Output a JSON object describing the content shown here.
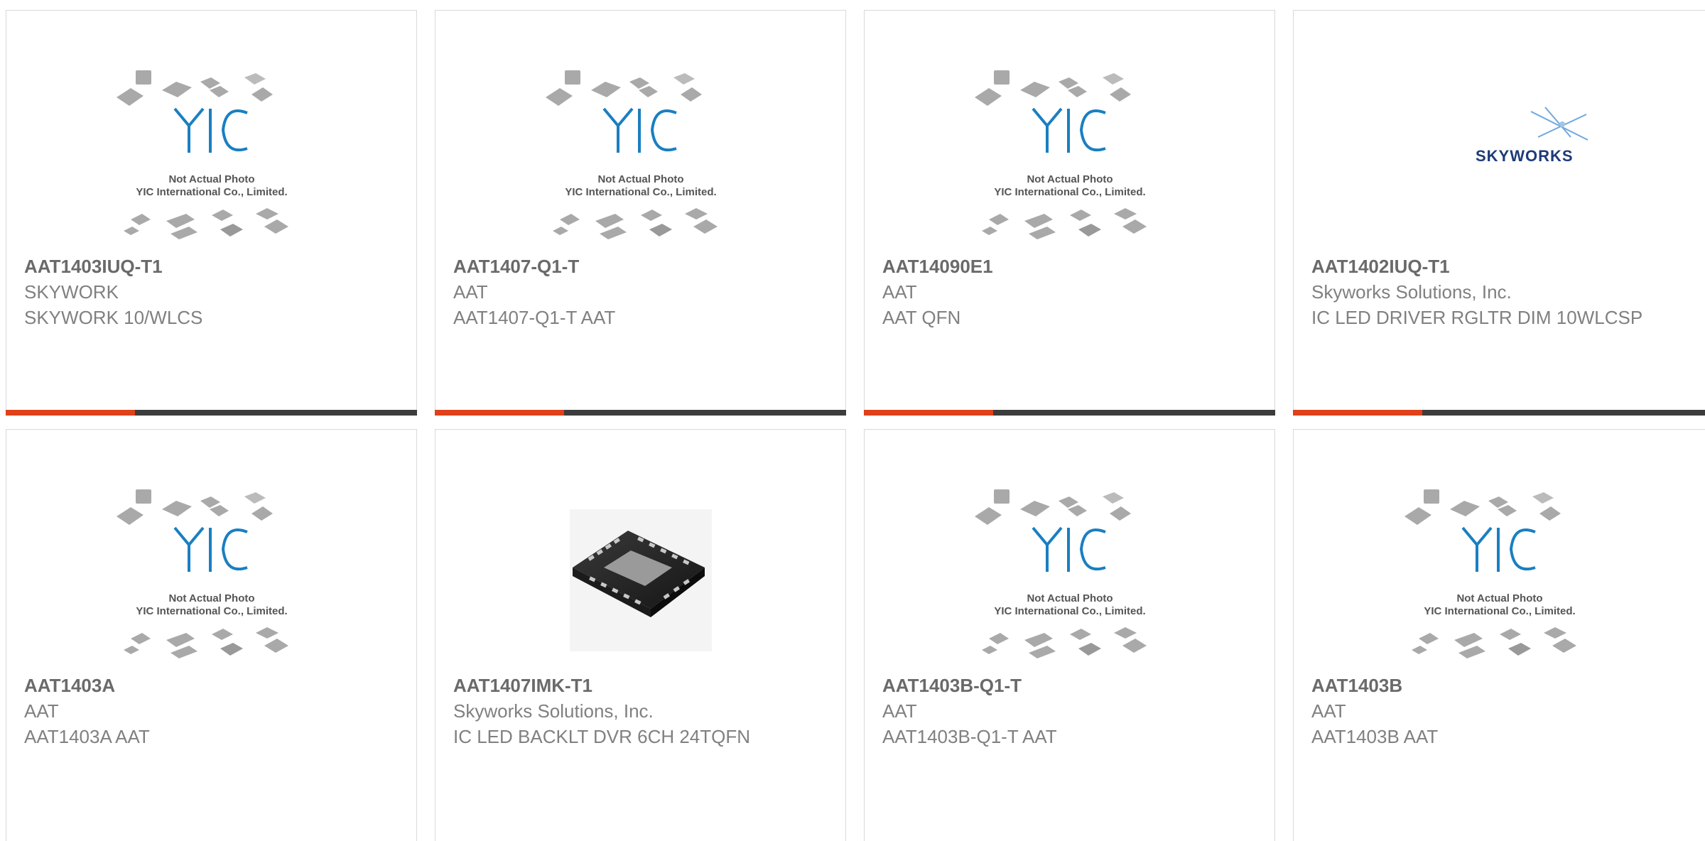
{
  "placeholder_image": {
    "line1": "Not Actual Photo",
    "line2": "YIC International Co., Limited."
  },
  "skyworks_logo_text": "SKYWORKS",
  "products": [
    {
      "part": "AAT1403IUQ-T1",
      "manufacturer": "SKYWORK",
      "description": "SKYWORK 10/WLCS",
      "image": "yic-placeholder"
    },
    {
      "part": "AAT1407-Q1-T",
      "manufacturer": "AAT",
      "description": "AAT1407-Q1-T AAT",
      "image": "yic-placeholder"
    },
    {
      "part": "AAT14090E1",
      "manufacturer": "AAT",
      "description": "AAT QFN",
      "image": "yic-placeholder"
    },
    {
      "part": "AAT1402IUQ-T1",
      "manufacturer": "Skyworks Solutions, Inc.",
      "description": "IC LED DRIVER RGLTR DIM 10WLCSP",
      "image": "skyworks-logo"
    },
    {
      "part": "AAT1403A",
      "manufacturer": "AAT",
      "description": "AAT1403A AAT",
      "image": "yic-placeholder"
    },
    {
      "part": "AAT1407IMK-T1",
      "manufacturer": "Skyworks Solutions, Inc.",
      "description": "IC LED BACKLT DVR 6CH 24TQFN",
      "image": "qfn-chip-photo"
    },
    {
      "part": "AAT1403B-Q1-T",
      "manufacturer": "AAT",
      "description": "AAT1403B-Q1-T AAT",
      "image": "yic-placeholder"
    },
    {
      "part": "AAT1403B",
      "manufacturer": "AAT",
      "description": "AAT1403B AAT",
      "image": "yic-placeholder"
    }
  ],
  "colors": {
    "accent": "#e0401a",
    "bar_dark": "#3c3c3c",
    "yic_blue": "#1a7fc1",
    "skyworks_navy": "#1e3a78"
  }
}
